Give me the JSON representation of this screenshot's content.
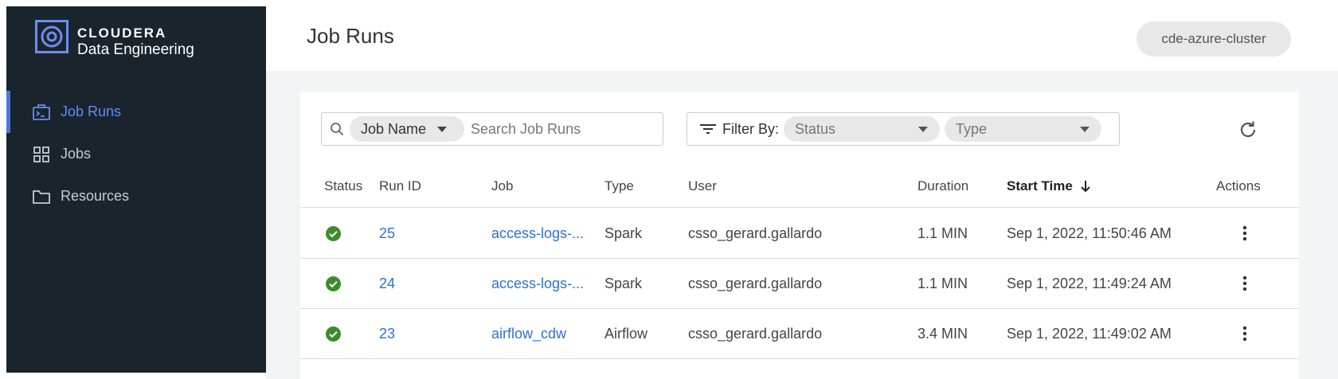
{
  "brand": {
    "name": "CLOUDERA",
    "product": "Data Engineering"
  },
  "sidebar": {
    "items": [
      {
        "label": "Job Runs",
        "icon": "terminal-briefcase-icon",
        "active": true
      },
      {
        "label": "Jobs",
        "icon": "grid-icon",
        "active": false
      },
      {
        "label": "Resources",
        "icon": "folder-icon",
        "active": false
      }
    ]
  },
  "header": {
    "title": "Job Runs",
    "cluster": "cde-azure-cluster"
  },
  "toolbar": {
    "search_field_select": "Job Name",
    "search_placeholder": "Search Job Runs",
    "filter_label": "Filter By:",
    "status_placeholder": "Status",
    "type_placeholder": "Type"
  },
  "table": {
    "columns": [
      "Status",
      "Run ID",
      "Job",
      "Type",
      "User",
      "Duration",
      "Start Time",
      "Actions"
    ],
    "sort_column": "Start Time",
    "rows": [
      {
        "status": "success",
        "run_id": "25",
        "job": "access-logs-...",
        "type": "Spark",
        "user": "csso_gerard.gallardo",
        "duration": "1.1 MIN",
        "start_time": "Sep 1, 2022, 11:50:46 AM"
      },
      {
        "status": "success",
        "run_id": "24",
        "job": "access-logs-...",
        "type": "Spark",
        "user": "csso_gerard.gallardo",
        "duration": "1.1 MIN",
        "start_time": "Sep 1, 2022, 11:49:24 AM"
      },
      {
        "status": "success",
        "run_id": "23",
        "job": "airflow_cdw",
        "type": "Airflow",
        "user": "csso_gerard.gallardo",
        "duration": "3.4 MIN",
        "start_time": "Sep 1, 2022, 11:49:02 AM"
      }
    ]
  },
  "colors": {
    "sidebar_bg": "#1a242c",
    "accent": "#5c8dff",
    "link": "#2f6fd6",
    "success": "#3d8b2f"
  }
}
